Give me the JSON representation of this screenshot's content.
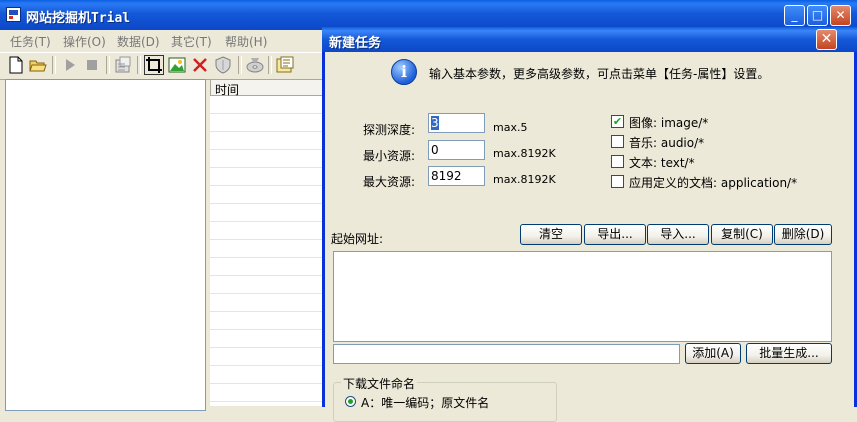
{
  "app": {
    "title": "网站挖掘机Trial",
    "window_controls": {
      "minimize": "_",
      "maximize": "□",
      "close": "✕"
    }
  },
  "menu": [
    "任务(T)",
    "操作(O)",
    "数据(D)",
    "其它(T)",
    "帮助(H)"
  ],
  "toolbar_icons": [
    "new-file-icon",
    "open-folder-icon",
    "play-icon",
    "stop-icon",
    "properties-icon",
    "crop-icon",
    "image-icon",
    "delete-icon",
    "shield-icon",
    "cd-icon",
    "export-icon"
  ],
  "log": {
    "column_time": "时间"
  },
  "dialog": {
    "title": "新建任务",
    "close": "✕",
    "info_icon": "i",
    "info_text": "输入基本参数，更多高级参数，可点击菜单【任务-属性】设置。",
    "params": [
      {
        "label": "探测深度:",
        "value": "3",
        "max": "max.5"
      },
      {
        "label": "最小资源:",
        "value": "0",
        "max": "max.8192K"
      },
      {
        "label": "最大资源:",
        "value": "8192",
        "max": "max.8192K"
      }
    ],
    "types": [
      {
        "label": "图像: image/*",
        "checked": true
      },
      {
        "label": "音乐: audio/*",
        "checked": false
      },
      {
        "label": "文本: text/*",
        "checked": false
      },
      {
        "label": "应用定义的文档: application/*",
        "checked": false
      }
    ],
    "url_label": "起始网址:",
    "buttons": {
      "clear": "清空",
      "export": "导出...",
      "import": "导入...",
      "copy": "复制(C)",
      "delete": "删除(D)"
    },
    "add_button": "添加(A)",
    "batch_button": "批量生成...",
    "naming": {
      "group_title": "下载文件命名",
      "option1": "A：唯一编码；原文件名"
    }
  }
}
